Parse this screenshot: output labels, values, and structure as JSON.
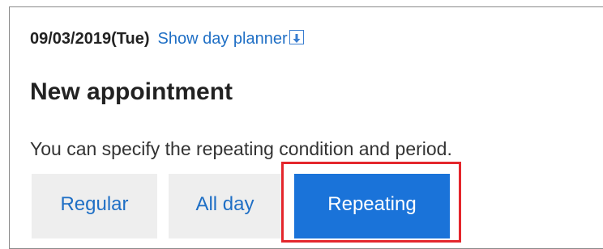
{
  "header": {
    "date": "09/03/2019(Tue)",
    "planner_link": "Show day planner"
  },
  "page": {
    "title": "New appointment",
    "description": "You can specify the repeating condition and period."
  },
  "tabs": [
    {
      "label": "Regular",
      "selected": false
    },
    {
      "label": "All day",
      "selected": false
    },
    {
      "label": "Repeating",
      "selected": true
    }
  ],
  "colors": {
    "link": "#1f6fc5",
    "selected_tab": "#1a73d9",
    "highlight": "#e4262c"
  },
  "icons": {
    "planner_toggle": "arrow-down-icon"
  }
}
